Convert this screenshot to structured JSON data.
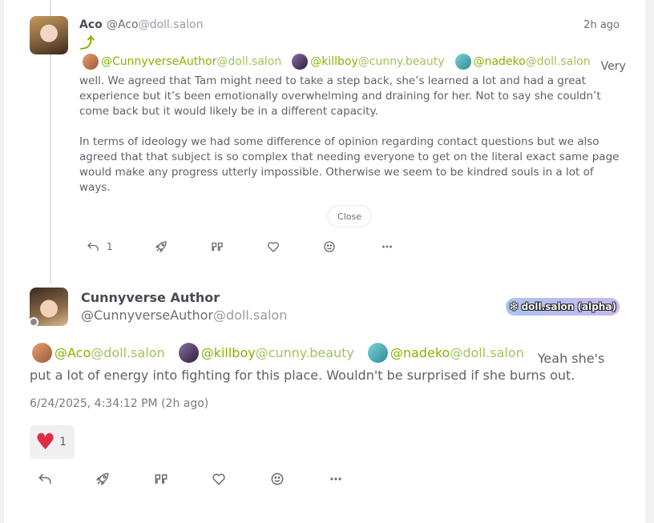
{
  "reply": {
    "author_name": "Aco",
    "handle_user": "@Aco",
    "handle_host": "@doll.salon",
    "time": "2h ago",
    "mentions": [
      {
        "user": "@CunnyverseAuthor",
        "host": "@doll.salon"
      },
      {
        "user": "@killboy",
        "host": "@cunny.beauty"
      },
      {
        "user": "@nadeko",
        "host": "@doll.salon"
      }
    ],
    "lead_word": "Very",
    "paragraph1": "well. We agreed that Tam might need to take a step back, she’s learned a lot and had a great experience but it’s been emotionally overwhelming and draining for her. Not to say she couldn’t come back but it would likely be in a different capacity.",
    "paragraph2": "In terms of ideology we had some difference of opinion regarding contact questions but we also agreed that that subject is so complex that needing everyone to get on the literal exact same page would make any progress utterly impossible. Otherwise we seem to be kindred souls in a lot of ways.",
    "close_label": "Close",
    "reply_count": "1",
    "icons": [
      "reply-icon",
      "renote-icon",
      "quote-icon",
      "heart-icon",
      "emoji-icon",
      "more-icon"
    ]
  },
  "note": {
    "author_name": "Cunnyverse Author",
    "handle_user": "@CunnyverseAuthor",
    "handle_host": "@doll.salon",
    "instance_badge": "doll.salon (alpha)",
    "mentions": [
      {
        "user": "@Aco",
        "host": "@doll.salon"
      },
      {
        "user": "@killboy",
        "host": "@cunny.beauty"
      },
      {
        "user": "@nadeko",
        "host": "@doll.salon"
      }
    ],
    "text_line1": "Yeah she's",
    "text_line2": "put a lot of energy into fighting for this place. Wouldn't be surprised if she burns out.",
    "datetime": "6/24/2025, 4:34:12 PM (2h ago)",
    "reaction_emoji": "heart",
    "reaction_count": "1",
    "icons": [
      "reply-icon",
      "renote-icon",
      "quote-icon",
      "heart-icon",
      "emoji-icon",
      "more-icon"
    ]
  },
  "colors": {
    "accent": "#86b300",
    "host": "#a3c25a",
    "text": "#5f5f6b",
    "reaction_heart": "#dd2e44"
  }
}
